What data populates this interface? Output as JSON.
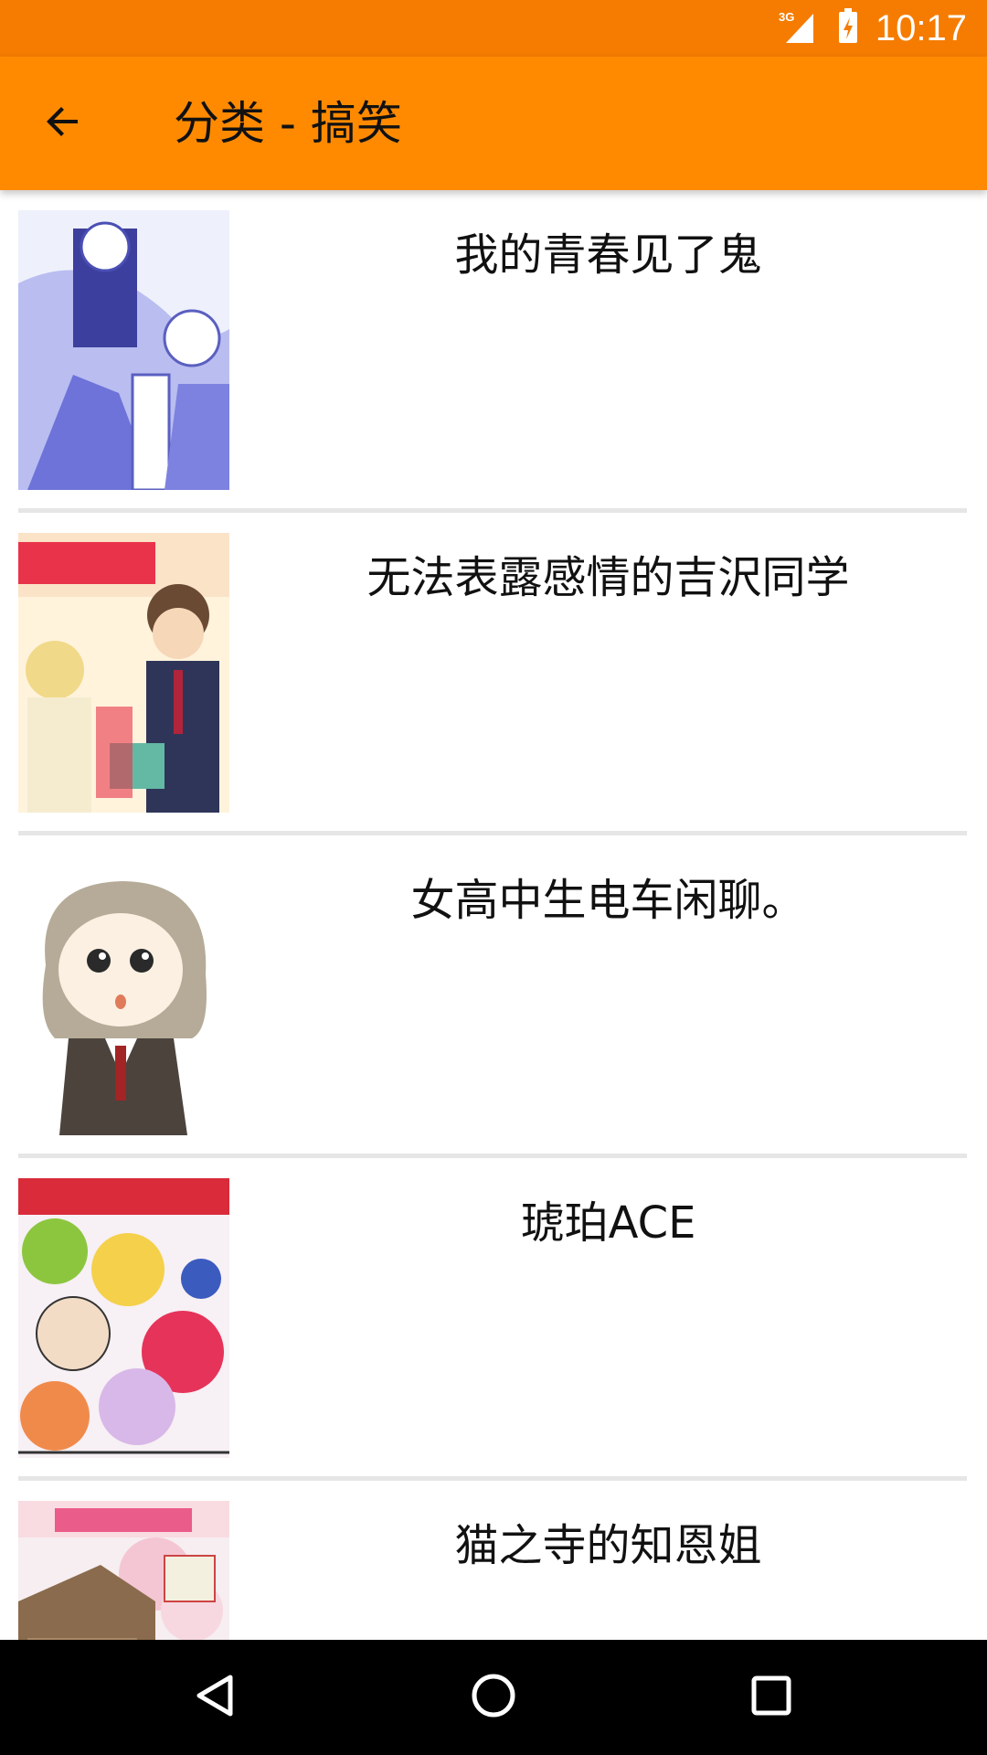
{
  "status_bar": {
    "network_label": "3G",
    "time": "10:17",
    "color": "#f57c00"
  },
  "app_bar": {
    "back_icon": "arrow-back-icon",
    "title": "分类 - 搞笑",
    "color": "#ff8a00"
  },
  "list": {
    "items": [
      {
        "title": "我的青春见了鬼",
        "cover": "cover-image"
      },
      {
        "title": "无法表露感情的吉沢同学",
        "cover": "cover-image"
      },
      {
        "title": "女高中生电车闲聊。",
        "cover": "cover-image"
      },
      {
        "title": "琥珀ACE",
        "cover": "cover-image"
      },
      {
        "title": "猫之寺的知恩姐",
        "cover": "cover-image"
      }
    ]
  },
  "nav_bar": {
    "back_icon": "nav-back-icon",
    "home_icon": "nav-home-icon",
    "recents_icon": "nav-recents-icon"
  }
}
